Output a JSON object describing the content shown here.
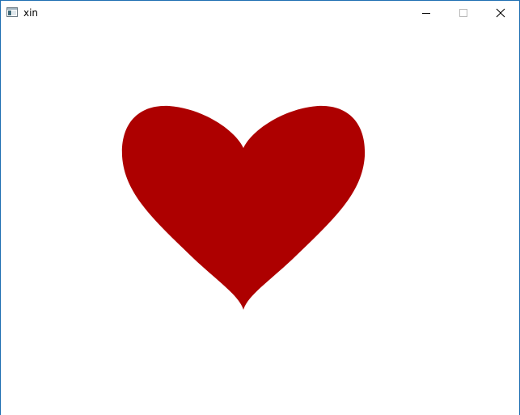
{
  "window": {
    "title": "xin",
    "app_icon": "window-app-icon",
    "controls": {
      "minimize_icon": "minimize-icon",
      "maximize_icon": "maximize-icon",
      "close_icon": "close-icon"
    }
  },
  "canvas": {
    "background": "#ffffff",
    "shape": "heart",
    "heart_color": "#ad0000"
  },
  "colors": {
    "window_border": "#1f6fb2",
    "title_text": "#000000"
  }
}
